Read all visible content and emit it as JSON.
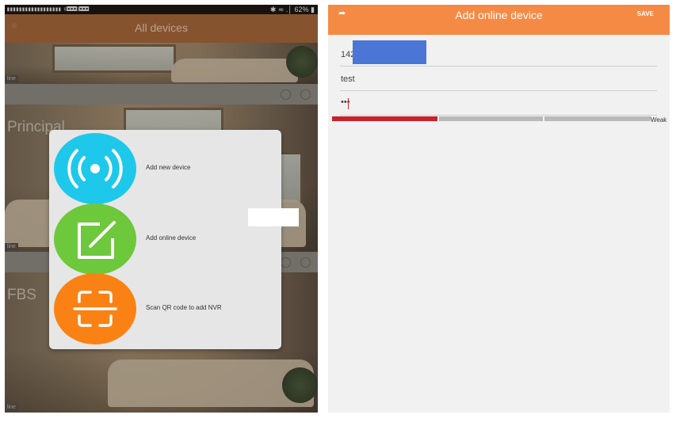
{
  "left_screen": {
    "status_right": "✱ ≂ .│ 62% ▮",
    "app_title": "All devices",
    "cameras": [
      {
        "name": "",
        "status": "line"
      },
      {
        "name": "Principal",
        "status": "line"
      },
      {
        "name": "FBS",
        "status": "line"
      }
    ],
    "dialog": {
      "options": [
        {
          "label": "Add new device",
          "icon": "wireless-signal-icon",
          "color": "#1ec8ea"
        },
        {
          "label": "Add online device",
          "icon": "edit-square-icon",
          "color": "#6dc83c"
        },
        {
          "label": "Scan QR code to add NVR",
          "icon": "scan-frame-icon",
          "color": "#fa8214"
        }
      ]
    }
  },
  "right_screen": {
    "back_icon": "back-arrow-icon",
    "title": "Add online device",
    "save_label": "SAVE",
    "fields": {
      "device_id": "142",
      "username": "test",
      "password": "•••"
    },
    "password_strength": {
      "label": "Weak",
      "level": 0.33,
      "active_color": "#c9222c",
      "inactive_color": "#b9b9b9"
    },
    "accent_color": "#f58a45"
  }
}
